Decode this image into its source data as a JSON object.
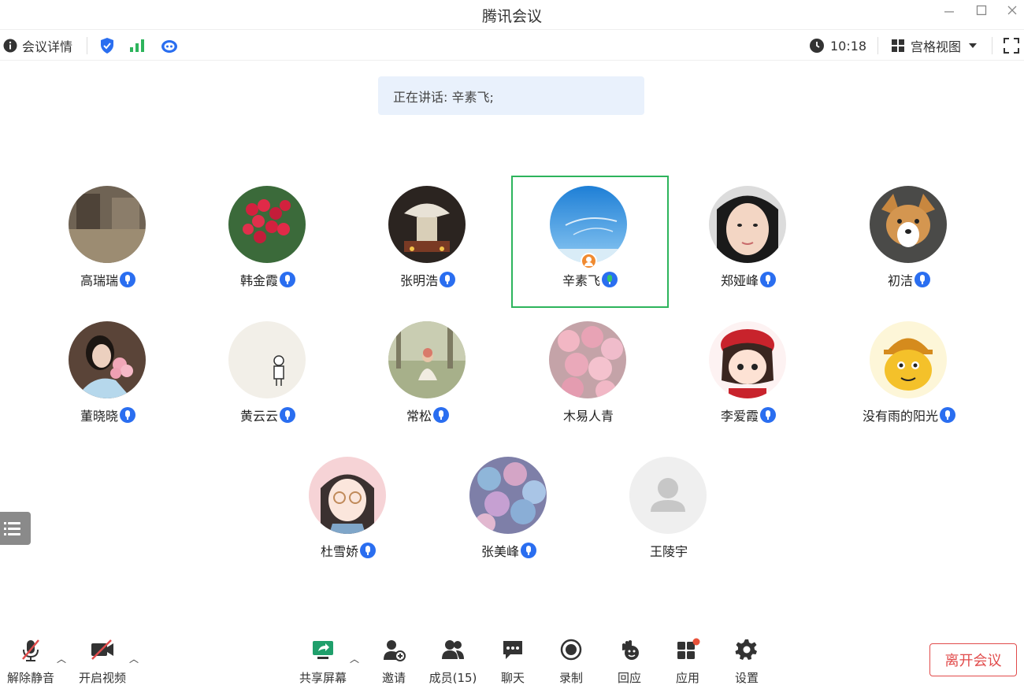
{
  "window": {
    "title": "腾讯会议"
  },
  "toolbar": {
    "meeting_details": "会议详情",
    "time": "10:18",
    "view_mode": "宫格视图"
  },
  "speaking": {
    "text": "正在讲话: 辛素飞;"
  },
  "participants": [
    {
      "name": "高瑞瑞",
      "mic": true
    },
    {
      "name": "韩金霞",
      "mic": true
    },
    {
      "name": "张明浩",
      "mic": true
    },
    {
      "name": "辛素飞",
      "mic": true,
      "active": true,
      "host": true
    },
    {
      "name": "郑娅峰",
      "mic": true
    },
    {
      "name": "初洁",
      "mic": true
    },
    {
      "name": "董晓晓",
      "mic": true
    },
    {
      "name": "黄云云",
      "mic": true
    },
    {
      "name": "常松",
      "mic": true
    },
    {
      "name": "木易人青",
      "mic": false
    },
    {
      "name": "李爱霞",
      "mic": true
    },
    {
      "name": "没有雨的阳光",
      "mic": true
    },
    {
      "name": "杜雪娇",
      "mic": true
    },
    {
      "name": "张美峰",
      "mic": true
    },
    {
      "name": "王陵宇",
      "mic": false
    }
  ],
  "bottombar": {
    "unmute": "解除静音",
    "start_video": "开启视频",
    "share_screen": "共享屏幕",
    "invite": "邀请",
    "members": "成员(15)",
    "chat": "聊天",
    "record": "录制",
    "reactions": "回应",
    "apps": "应用",
    "settings": "设置",
    "leave": "离开会议"
  },
  "colors": {
    "active_border": "#2db45c",
    "mic_blue": "#2a6ef0",
    "leave_red": "#e14b4b",
    "banner_bg": "#e9f1fc"
  }
}
